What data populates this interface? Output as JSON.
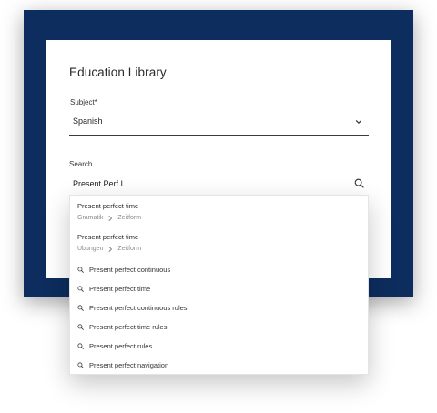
{
  "header": {
    "title": "Education Library"
  },
  "subject": {
    "label": "Subject*",
    "value": "Spanish"
  },
  "search": {
    "label": "Search",
    "value": "Present Perf I"
  },
  "results": [
    {
      "title": "Present perfect time",
      "path": [
        "Gramatik",
        "Zeitform"
      ]
    },
    {
      "title": "Present perfect time",
      "path": [
        "Ubungen",
        "Zeitform"
      ]
    }
  ],
  "suggestions": [
    "Present perfect continuous",
    "Present perfect time",
    "Present perfect continuous rules",
    "Present perfect time rules",
    "Present perfect rules",
    "Present perfect navigation"
  ],
  "colors": {
    "frame": "#0d2d5e",
    "card": "#ffffff"
  },
  "icons": {
    "subject_toggle": "chevron-down-icon",
    "search": "search-icon",
    "breadcrumb_separator": "chevron-right-icon",
    "suggestion": "search-icon"
  }
}
